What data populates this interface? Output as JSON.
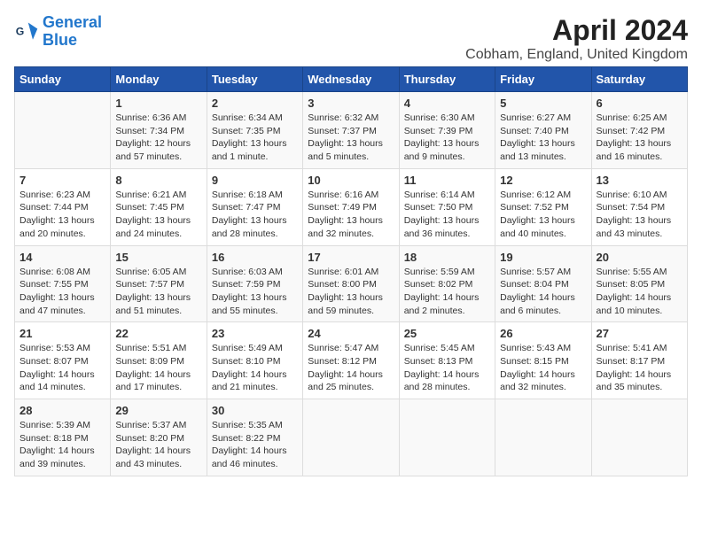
{
  "logo": {
    "line1": "General",
    "line2": "Blue"
  },
  "title": "April 2024",
  "subtitle": "Cobham, England, United Kingdom",
  "days_of_week": [
    "Sunday",
    "Monday",
    "Tuesday",
    "Wednesday",
    "Thursday",
    "Friday",
    "Saturday"
  ],
  "weeks": [
    [
      {
        "day": "",
        "info": ""
      },
      {
        "day": "1",
        "info": "Sunrise: 6:36 AM\nSunset: 7:34 PM\nDaylight: 12 hours\nand 57 minutes."
      },
      {
        "day": "2",
        "info": "Sunrise: 6:34 AM\nSunset: 7:35 PM\nDaylight: 13 hours\nand 1 minute."
      },
      {
        "day": "3",
        "info": "Sunrise: 6:32 AM\nSunset: 7:37 PM\nDaylight: 13 hours\nand 5 minutes."
      },
      {
        "day": "4",
        "info": "Sunrise: 6:30 AM\nSunset: 7:39 PM\nDaylight: 13 hours\nand 9 minutes."
      },
      {
        "day": "5",
        "info": "Sunrise: 6:27 AM\nSunset: 7:40 PM\nDaylight: 13 hours\nand 13 minutes."
      },
      {
        "day": "6",
        "info": "Sunrise: 6:25 AM\nSunset: 7:42 PM\nDaylight: 13 hours\nand 16 minutes."
      }
    ],
    [
      {
        "day": "7",
        "info": "Sunrise: 6:23 AM\nSunset: 7:44 PM\nDaylight: 13 hours\nand 20 minutes."
      },
      {
        "day": "8",
        "info": "Sunrise: 6:21 AM\nSunset: 7:45 PM\nDaylight: 13 hours\nand 24 minutes."
      },
      {
        "day": "9",
        "info": "Sunrise: 6:18 AM\nSunset: 7:47 PM\nDaylight: 13 hours\nand 28 minutes."
      },
      {
        "day": "10",
        "info": "Sunrise: 6:16 AM\nSunset: 7:49 PM\nDaylight: 13 hours\nand 32 minutes."
      },
      {
        "day": "11",
        "info": "Sunrise: 6:14 AM\nSunset: 7:50 PM\nDaylight: 13 hours\nand 36 minutes."
      },
      {
        "day": "12",
        "info": "Sunrise: 6:12 AM\nSunset: 7:52 PM\nDaylight: 13 hours\nand 40 minutes."
      },
      {
        "day": "13",
        "info": "Sunrise: 6:10 AM\nSunset: 7:54 PM\nDaylight: 13 hours\nand 43 minutes."
      }
    ],
    [
      {
        "day": "14",
        "info": "Sunrise: 6:08 AM\nSunset: 7:55 PM\nDaylight: 13 hours\nand 47 minutes."
      },
      {
        "day": "15",
        "info": "Sunrise: 6:05 AM\nSunset: 7:57 PM\nDaylight: 13 hours\nand 51 minutes."
      },
      {
        "day": "16",
        "info": "Sunrise: 6:03 AM\nSunset: 7:59 PM\nDaylight: 13 hours\nand 55 minutes."
      },
      {
        "day": "17",
        "info": "Sunrise: 6:01 AM\nSunset: 8:00 PM\nDaylight: 13 hours\nand 59 minutes."
      },
      {
        "day": "18",
        "info": "Sunrise: 5:59 AM\nSunset: 8:02 PM\nDaylight: 14 hours\nand 2 minutes."
      },
      {
        "day": "19",
        "info": "Sunrise: 5:57 AM\nSunset: 8:04 PM\nDaylight: 14 hours\nand 6 minutes."
      },
      {
        "day": "20",
        "info": "Sunrise: 5:55 AM\nSunset: 8:05 PM\nDaylight: 14 hours\nand 10 minutes."
      }
    ],
    [
      {
        "day": "21",
        "info": "Sunrise: 5:53 AM\nSunset: 8:07 PM\nDaylight: 14 hours\nand 14 minutes."
      },
      {
        "day": "22",
        "info": "Sunrise: 5:51 AM\nSunset: 8:09 PM\nDaylight: 14 hours\nand 17 minutes."
      },
      {
        "day": "23",
        "info": "Sunrise: 5:49 AM\nSunset: 8:10 PM\nDaylight: 14 hours\nand 21 minutes."
      },
      {
        "day": "24",
        "info": "Sunrise: 5:47 AM\nSunset: 8:12 PM\nDaylight: 14 hours\nand 25 minutes."
      },
      {
        "day": "25",
        "info": "Sunrise: 5:45 AM\nSunset: 8:13 PM\nDaylight: 14 hours\nand 28 minutes."
      },
      {
        "day": "26",
        "info": "Sunrise: 5:43 AM\nSunset: 8:15 PM\nDaylight: 14 hours\nand 32 minutes."
      },
      {
        "day": "27",
        "info": "Sunrise: 5:41 AM\nSunset: 8:17 PM\nDaylight: 14 hours\nand 35 minutes."
      }
    ],
    [
      {
        "day": "28",
        "info": "Sunrise: 5:39 AM\nSunset: 8:18 PM\nDaylight: 14 hours\nand 39 minutes."
      },
      {
        "day": "29",
        "info": "Sunrise: 5:37 AM\nSunset: 8:20 PM\nDaylight: 14 hours\nand 43 minutes."
      },
      {
        "day": "30",
        "info": "Sunrise: 5:35 AM\nSunset: 8:22 PM\nDaylight: 14 hours\nand 46 minutes."
      },
      {
        "day": "",
        "info": ""
      },
      {
        "day": "",
        "info": ""
      },
      {
        "day": "",
        "info": ""
      },
      {
        "day": "",
        "info": ""
      }
    ]
  ]
}
